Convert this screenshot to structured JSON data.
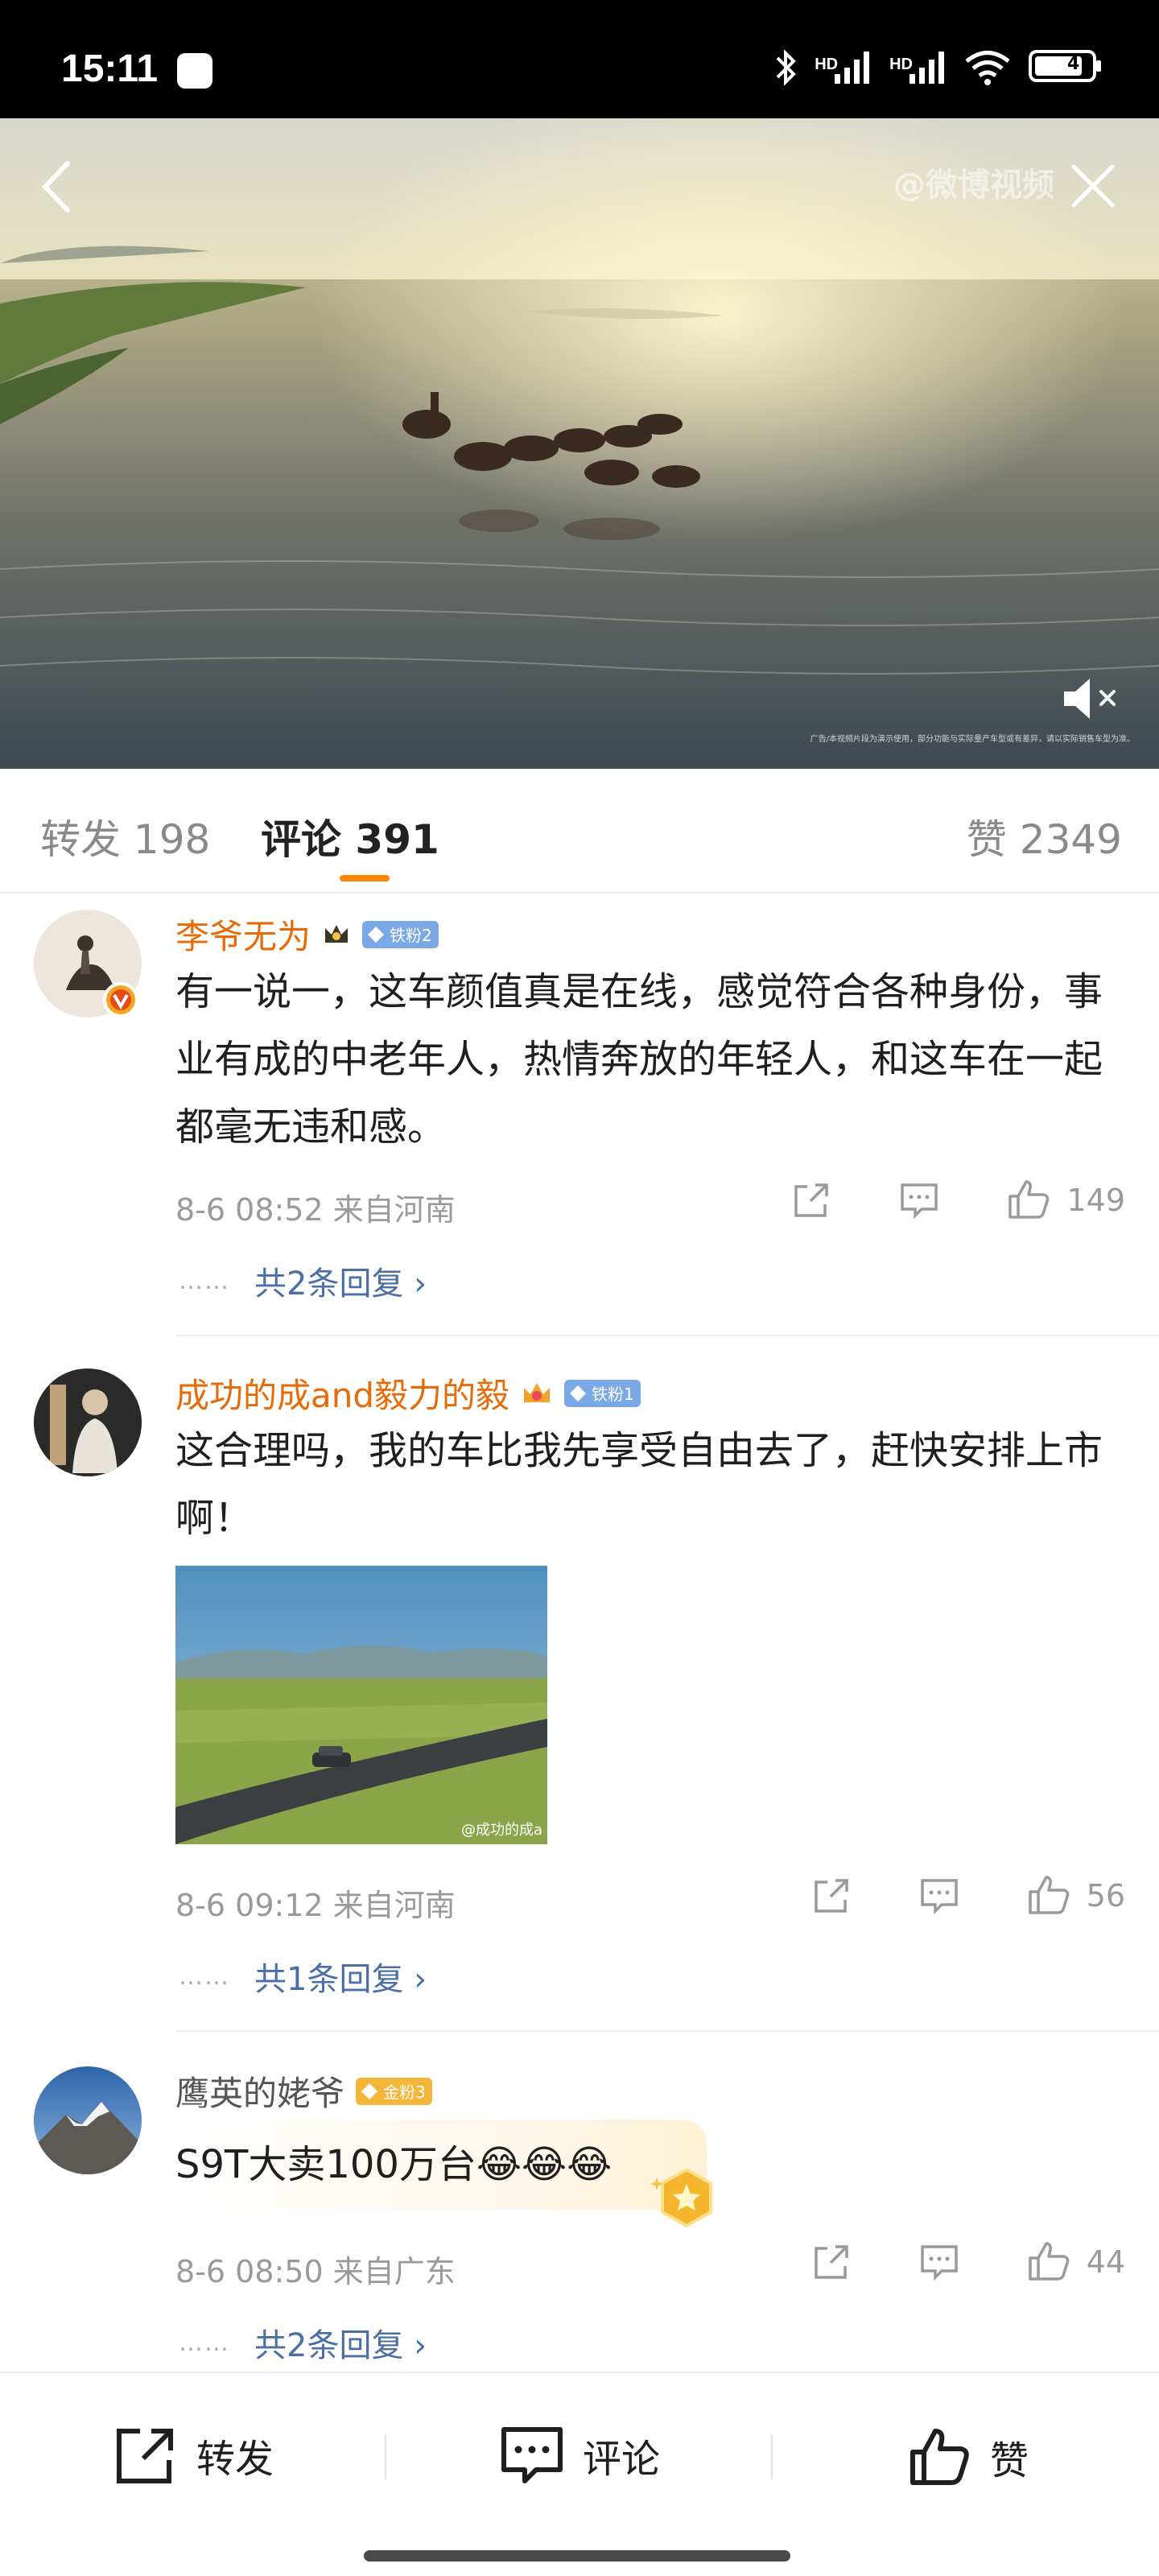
{
  "status_bar": {
    "time": "15:11",
    "signal1_label": "HD",
    "signal2_label": "HD",
    "battery": "4"
  },
  "video": {
    "watermark": "@微博视频",
    "disclaimer": "广告/本视频片段为演示使用，部分功能与实际量产车型或有差异，请以实际销售车型为准。"
  },
  "tabs": {
    "repost": "转发 198",
    "comment": "评论 391",
    "like": "赞 2349"
  },
  "comments": [
    {
      "name": "李爷无为",
      "badge_text": "铁粉2",
      "badge_type": "iron",
      "text": "有一说一，这车颜值真是在线，感觉符合各种身份，事业有成的中老年人，热情奔放的年轻人，和这车在一起都毫无违和感。",
      "time_location": "8-6 08:52  来自河南",
      "likes": "149",
      "replies": "共2条回复 ›"
    },
    {
      "name": "成功的成and毅力的毅",
      "badge_text": "铁粉1",
      "badge_type": "iron",
      "text": "这合理吗，我的车比我先享受自由去了，赶快安排上市啊！",
      "image_watermark": "@成功的成a",
      "time_location": "8-6 09:12  来自河南",
      "likes": "56",
      "replies": "共1条回复 ›"
    },
    {
      "name": "鹰英的姥爷",
      "badge_text": "金粉3",
      "badge_type": "gold",
      "text": "S9T大卖100万台😂😂😂",
      "time_location": "8-6 08:50  来自广东",
      "likes": "44",
      "replies": "共2条回复 ›"
    }
  ],
  "reply_dots": "……",
  "bottom_bar": {
    "repost": "转发",
    "comment": "评论",
    "like": "赞"
  },
  "colors": {
    "accent": "#ff8200",
    "username": "#e86b0a",
    "link": "#4b6fa5",
    "meta": "#9a9a9a"
  }
}
